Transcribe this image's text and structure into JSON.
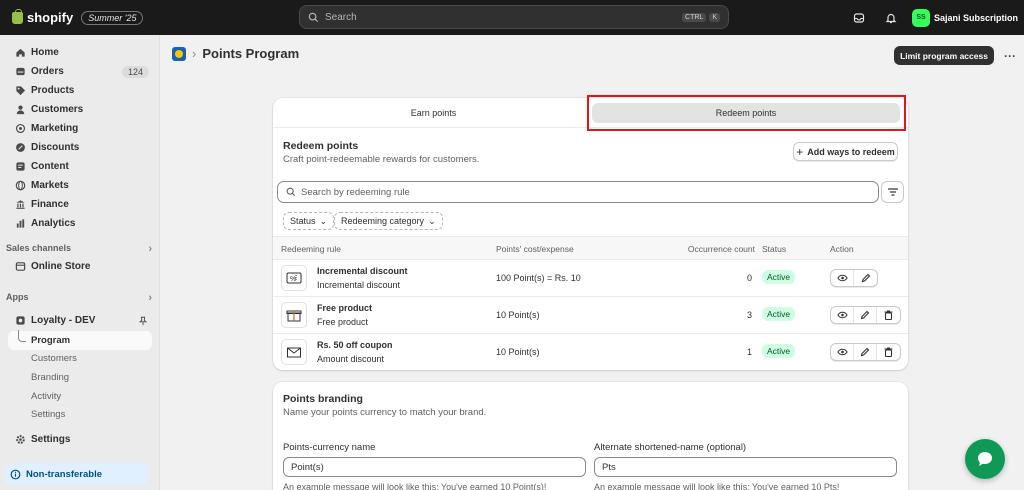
{
  "topbar": {
    "brand": "shopify",
    "edition": "Summer '25",
    "search_placeholder": "Search",
    "shortcut_keys": [
      "CTRL",
      "K"
    ],
    "store_initials": "SS",
    "store_name": "Sajani Subscription"
  },
  "sidebar": {
    "items": [
      {
        "label": "Home",
        "icon": "home-icon"
      },
      {
        "label": "Orders",
        "icon": "orders-icon",
        "badge": "124"
      },
      {
        "label": "Products",
        "icon": "tag-icon"
      },
      {
        "label": "Customers",
        "icon": "person-icon"
      },
      {
        "label": "Marketing",
        "icon": "target-icon"
      },
      {
        "label": "Discounts",
        "icon": "discount-icon"
      },
      {
        "label": "Content",
        "icon": "content-icon"
      },
      {
        "label": "Markets",
        "icon": "globe-icon"
      },
      {
        "label": "Finance",
        "icon": "bank-icon"
      },
      {
        "label": "Analytics",
        "icon": "chart-icon"
      }
    ],
    "sales_channels_title": "Sales channels",
    "online_store": "Online Store",
    "apps_title": "Apps",
    "app_name": "Loyalty - DEV",
    "app_sub": [
      "Program",
      "Customers",
      "Branding",
      "Activity",
      "Settings"
    ],
    "settings": "Settings",
    "notice": "Non-transferable"
  },
  "page": {
    "title": "Points Program",
    "primary_action": "Limit program access"
  },
  "tabs": [
    "Earn points",
    "Redeem points"
  ],
  "redeem": {
    "title": "Redeem points",
    "subtitle": "Craft point-redeemable rewards for customers.",
    "add_button": "Add ways to redeem",
    "search_placeholder": "Search by redeeming rule",
    "filters": [
      "Status",
      "Redeeming category"
    ],
    "columns": [
      "Redeeming rule",
      "Points' cost/expense",
      "Occurrence count",
      "Status",
      "Action"
    ],
    "rows": [
      {
        "name": "Incremental discount",
        "desc": "Incremental discount",
        "cost": "100 Point(s) = Rs. 10",
        "count": "0",
        "status": "Active"
      },
      {
        "name": "Free product",
        "desc": "Free product",
        "cost": "10 Point(s)",
        "count": "3",
        "status": "Active"
      },
      {
        "name": "Rs. 50 off coupon",
        "desc": "Amount discount",
        "cost": "10 Point(s)",
        "count": "1",
        "status": "Active"
      }
    ]
  },
  "branding": {
    "title": "Points branding",
    "subtitle": "Name your points currency to match your brand.",
    "currency_label": "Points-currency name",
    "currency_value": "Point(s)",
    "currency_help": "An example message will look like this: You've earned 10 Point(s)!",
    "short_label": "Alternate shortened-name (optional)",
    "short_value": "Pts",
    "short_help": "An example message will look like this: You've earned 10 Pts!"
  },
  "colors": {
    "accent": "#303030",
    "highlight": "#e5141b",
    "active_badge": "#cdfee1",
    "chat": "#0e9a56"
  }
}
